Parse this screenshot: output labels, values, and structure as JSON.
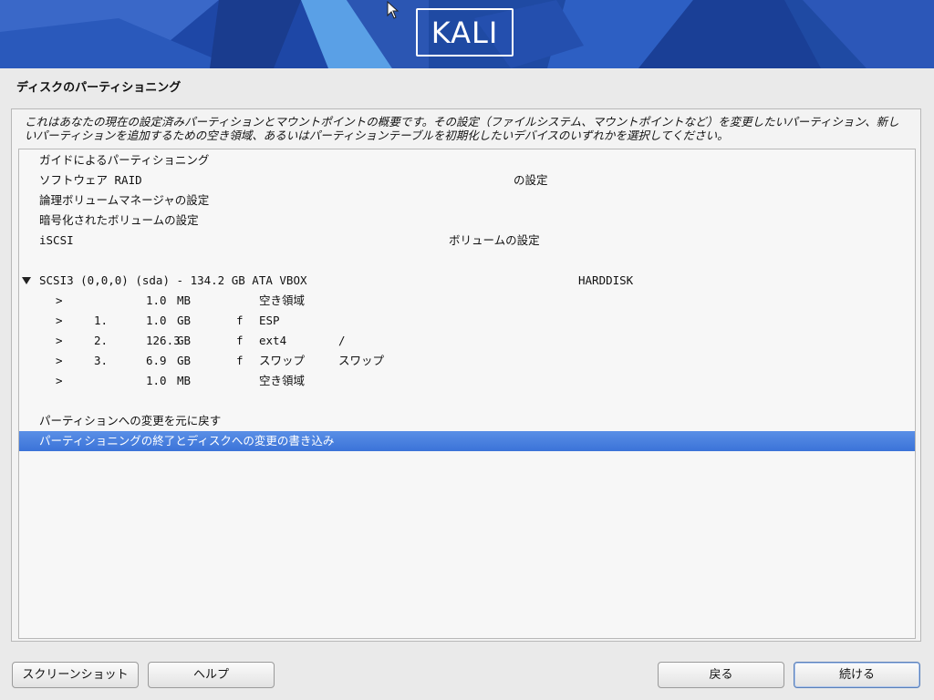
{
  "banner": {
    "logo_text": "KALI",
    "colors": {
      "dark_blue": "#1d3f8f",
      "mid_blue": "#2c5bc0",
      "light_blue": "#5aa0e6"
    }
  },
  "page": {
    "title": "ディスクのパーティショニング"
  },
  "description": "これはあなたの現在の設定済みパーティションとマウントポイントの概要です。その設定（ファイルシステム、マウントポイントなど）を変更したいパーティション、新しいパーティションを追加するための空き領域、あるいはパーティションテーブルを初期化したいデバイスのいずれかを選択してください。",
  "menu": {
    "guided": "ガイドによるパーティショニング",
    "raid_left": "ソフトウェア RAID",
    "raid_right": "の設定",
    "lvm": "論理ボリュームマネージャの設定",
    "crypto": "暗号化されたボリュームの設定",
    "iscsi_left": "iSCSI",
    "iscsi_right": "ボリュームの設定"
  },
  "disk": {
    "label": "SCSI3 (0,0,0) (sda) - 134.2 GB ATA VBOX",
    "model": "HARDDISK",
    "partitions": [
      {
        "arrow": ">",
        "num": "",
        "size": "1.0",
        "unit": "MB",
        "flag": "",
        "fs": "空き領域",
        "mount": ""
      },
      {
        "arrow": ">",
        "num": "1.",
        "size": "1.0",
        "unit": "GB",
        "flag": "f",
        "fs": "ESP",
        "mount": ""
      },
      {
        "arrow": ">",
        "num": "2.",
        "size": "126.3",
        "unit": "GB",
        "flag": "f",
        "fs": "ext4",
        "mount": "/"
      },
      {
        "arrow": ">",
        "num": "3.",
        "size": "6.9",
        "unit": "GB",
        "flag": "f",
        "fs": "スワップ",
        "mount": "スワップ"
      },
      {
        "arrow": ">",
        "num": "",
        "size": "1.0",
        "unit": "MB",
        "flag": "",
        "fs": "空き領域",
        "mount": ""
      }
    ]
  },
  "actions": {
    "undo": "パーティションへの変更を元に戻す",
    "finish": "パーティショニングの終了とディスクへの変更の書き込み"
  },
  "buttons": {
    "screenshot": "スクリーンショット",
    "help": "ヘルプ",
    "back": "戻る",
    "continue": "続ける"
  },
  "selection_color": "#3b73d8"
}
